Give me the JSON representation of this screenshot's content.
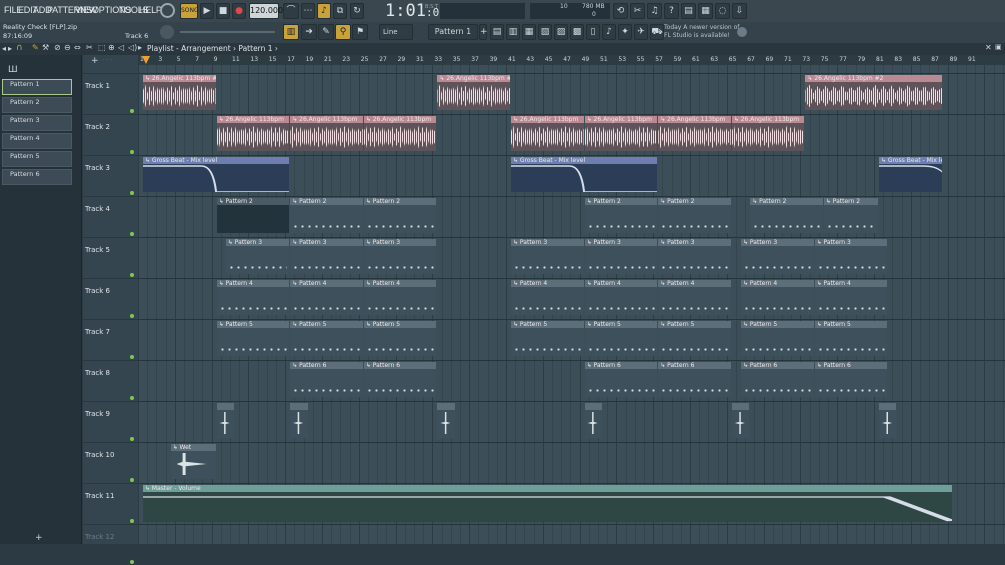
{
  "menu": {
    "items": [
      "FILE",
      "EDIT",
      "ADD",
      "PATTERNS",
      "VIEW",
      "OPTIONS",
      "TOOLS",
      "HELP"
    ]
  },
  "transport": {
    "mode": "SONG",
    "tempo": "120.000",
    "time": "1:01",
    "time_sub": ":00",
    "time_label": "B:S:T",
    "cpu": "10",
    "mem": "780 MB",
    "mem_sub": "0"
  },
  "hint": {
    "line1": "Today   A newer version of",
    "line2": "FL Studio is available!"
  },
  "project": {
    "name": "Reality Check [FLP].zip",
    "time": "87:16:09",
    "track": "Track 6"
  },
  "toolbar": {
    "snap": "Line",
    "pattern": "Pattern 1"
  },
  "playlist": {
    "breadcrumb": "Playlist - Arrangement › Pattern 1 ›"
  },
  "patterns": [
    "Pattern 1",
    "Pattern 2",
    "Pattern 3",
    "Pattern 4",
    "Pattern 5",
    "Pattern 6"
  ],
  "tracks": [
    "Track 1",
    "Track 2",
    "Track 3",
    "Track 4",
    "Track 5",
    "Track 6",
    "Track 7",
    "Track 8",
    "Track 9",
    "Track 10",
    "Track 11",
    "Track 12"
  ],
  "ruler": [
    "1",
    "3",
    "5",
    "7",
    "9",
    "11",
    "13",
    "15",
    "17",
    "19",
    "21",
    "23",
    "25",
    "27",
    "29",
    "31",
    "33",
    "35",
    "37",
    "39",
    "41",
    "43",
    "45",
    "47",
    "49",
    "51",
    "53",
    "55",
    "57",
    "59",
    "61",
    "63",
    "65",
    "67",
    "69",
    "71",
    "73",
    "75",
    "77",
    "79",
    "81",
    "83",
    "85",
    "87",
    "89",
    "91"
  ],
  "clips": {
    "angelic_2": "26.Angelic 113bpm #2",
    "angelic": "26.Angelic 113bpm",
    "gross": "Gross Beat - Mix level",
    "p2": "Pattern 2",
    "p3": "Pattern 3",
    "p4": "Pattern 4",
    "p5": "Pattern 5",
    "p6": "Pattern 6",
    "wet": "Wet",
    "master": "Master - Volume"
  },
  "colors": {
    "accent": "#f0a030",
    "audio": "#b98a93",
    "automation": "#6d7fb0",
    "pattern": "#5c6e79",
    "volume": "#6d9e98"
  }
}
